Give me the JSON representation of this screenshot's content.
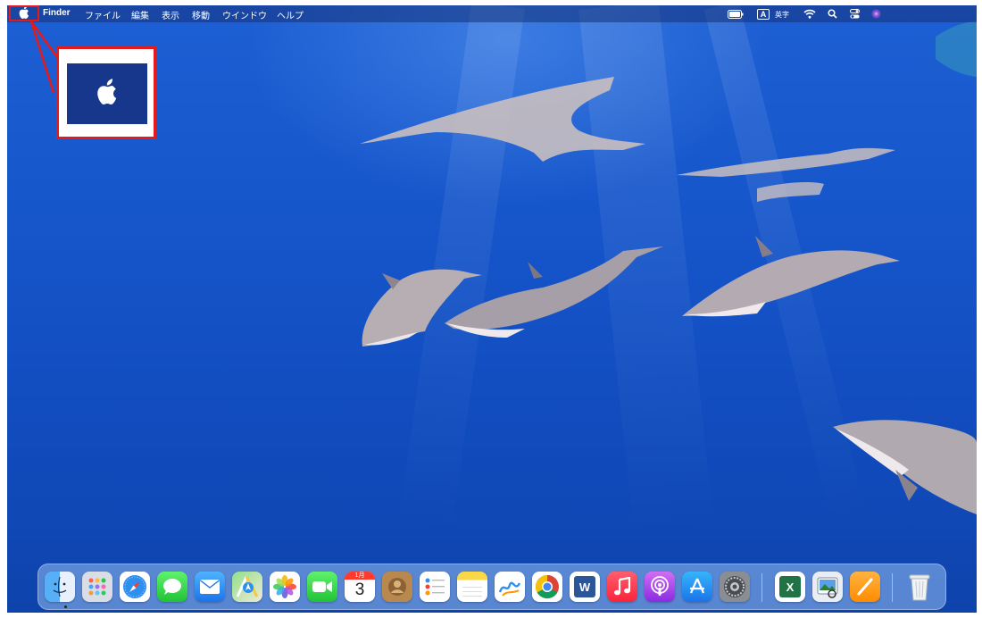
{
  "menubar": {
    "app_name": "Finder",
    "items": [
      "ファイル",
      "編集",
      "表示",
      "移動",
      "ウインドウ",
      "ヘルプ"
    ],
    "input_method": "英字",
    "input_badge": "A"
  },
  "callout": {
    "target": "apple-icon",
    "color": "#e51a1a"
  },
  "dock": {
    "apps": [
      {
        "name": "Finder",
        "icon": "finder-icon"
      },
      {
        "name": "Launchpad",
        "icon": "launchpad-icon"
      },
      {
        "name": "Safari",
        "icon": "safari-icon"
      },
      {
        "name": "Messages",
        "icon": "messages-icon"
      },
      {
        "name": "Mail",
        "icon": "mail-icon"
      },
      {
        "name": "Maps",
        "icon": "maps-icon"
      },
      {
        "name": "Photos",
        "icon": "photos-icon"
      },
      {
        "name": "FaceTime",
        "icon": "facetime-icon"
      },
      {
        "name": "Calendar",
        "icon": "calendar-icon"
      },
      {
        "name": "Contacts",
        "icon": "contacts-icon"
      },
      {
        "name": "Reminders",
        "icon": "reminders-icon"
      },
      {
        "name": "Notes",
        "icon": "notes-icon"
      },
      {
        "name": "Freeform",
        "icon": "freeform-icon"
      },
      {
        "name": "Chrome",
        "icon": "chrome-icon"
      },
      {
        "name": "Word",
        "icon": "word-icon"
      },
      {
        "name": "Music",
        "icon": "music-icon"
      },
      {
        "name": "Podcasts",
        "icon": "podcasts-icon"
      },
      {
        "name": "App Store",
        "icon": "app-store-icon"
      },
      {
        "name": "System Settings",
        "icon": "system-settings-icon"
      },
      {
        "name": "Excel",
        "icon": "excel-icon"
      },
      {
        "name": "Preview",
        "icon": "preview-icon"
      },
      {
        "name": "Pages",
        "icon": "pages-icon"
      },
      {
        "name": "Trash",
        "icon": "trash-icon"
      }
    ],
    "calendar_month": "1月",
    "calendar_day": "3",
    "word_letter": "W",
    "excel_letter": "X"
  },
  "colors": {
    "accent_red": "#e51a1a",
    "ocean_top": "#1d5fd4",
    "ocean_bottom": "#0e43ab"
  }
}
